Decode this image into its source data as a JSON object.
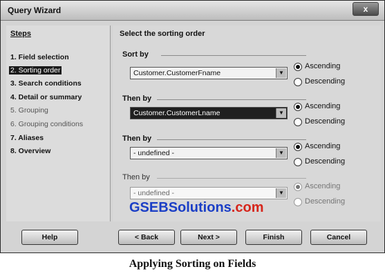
{
  "window": {
    "title": "Query Wizard",
    "close_label": "x"
  },
  "steps": {
    "title": "Steps",
    "items": [
      "1. Field selection",
      "2. Sorting order",
      "3. Search conditions",
      "4. Detail or summary",
      "5. Grouping",
      "6. Grouping conditions",
      "7. Aliases",
      "8. Overview"
    ]
  },
  "main": {
    "title": "Select the sorting order",
    "groups": [
      {
        "label": "Sort by",
        "value": "Customer.CustomerFname",
        "ascending": "Ascending",
        "descending": "Descending",
        "selected": "ascending"
      },
      {
        "label": "Then by",
        "value": "Customer.CustomerLname",
        "ascending": "Ascending",
        "descending": "Descending",
        "selected": "ascending"
      },
      {
        "label": "Then by",
        "value": "- undefined -",
        "ascending": "Ascending",
        "descending": "Descending",
        "selected": "ascending"
      },
      {
        "label": "Then by",
        "value": "- undefined -",
        "ascending": "Ascending",
        "descending": "Descending",
        "selected": "ascending"
      }
    ]
  },
  "buttons": {
    "help": "Help",
    "back": "< Back",
    "next": "Next >",
    "finish": "Finish",
    "cancel": "Cancel"
  },
  "watermark": {
    "part1": "GSEB",
    "part2": "Solutions",
    "part3": ".com"
  },
  "caption": "Applying Sorting on Fields"
}
